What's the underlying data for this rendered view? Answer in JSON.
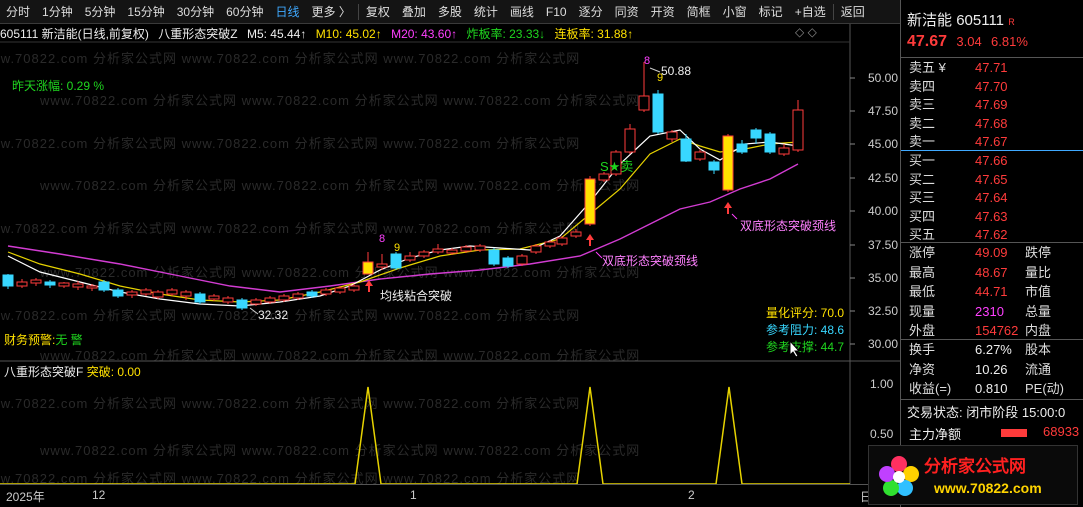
{
  "toolbar": {
    "items": [
      "分时",
      "1分钟",
      "5分钟",
      "15分钟",
      "30分钟",
      "60分钟",
      "日线",
      "更多 〉",
      "复权",
      "叠加",
      "多股",
      "统计",
      "画线",
      "F10",
      "逐分",
      "同资",
      "开资",
      "简框",
      "小窗",
      "标记",
      "+自选",
      "返回"
    ],
    "active_index": 6
  },
  "infobar": {
    "code_name": "605111  新洁能(日线,前复权)",
    "indicator_name": "八重形态突破Z",
    "ma5": "M5: 45.44↑",
    "ma10": "M10: 45.02↑",
    "ma20": "M20: 43.60↑",
    "zhaban": "炸板率: 23.33↓",
    "lianban": "连板率: 31.88↑"
  },
  "window_buttons": "◇ ◇",
  "annotations": {
    "zuotian": "昨天涨幅:  0.29 %",
    "caiwu_label": "财务预警:",
    "caiwu_value": "无 警",
    "price_high": "50.88",
    "price_low": "32.32",
    "label_junxian": "均线粘合突破",
    "label_neck1": "双底形态突破颈线",
    "label_neck2": "双底形态突破颈线",
    "sell_mark": "S★卖",
    "num8a": "8",
    "num9a": "9",
    "num8b": "8",
    "num9b": "9",
    "score_label": "量化评分: 70.0",
    "resist_label": "参考阻力: 48.6",
    "support_label": "参考支撑: 44.7"
  },
  "price_axis": [
    "50.00",
    "47.50",
    "45.00",
    "42.50",
    "40.00",
    "37.50",
    "35.00",
    "32.50",
    "30.00"
  ],
  "sub_axis": [
    "1.00",
    "0.50",
    "0.00"
  ],
  "subinfo": {
    "name": "八重形态突破F",
    "value": "突破: 0.00"
  },
  "xaxis": {
    "year": "2025年",
    "labels": [
      "12",
      "1",
      "2"
    ],
    "right_label": "日"
  },
  "right_panel": {
    "stock_name": "新洁能",
    "stock_code": "605111",
    "tag": "R",
    "price": "47.67",
    "change": "3.04",
    "change_pct": "6.81%",
    "asks": [
      {
        "label": "卖五 ¥",
        "price": "47.71"
      },
      {
        "label": "卖四",
        "price": "47.70"
      },
      {
        "label": "卖三",
        "price": "47.69"
      },
      {
        "label": "卖二",
        "price": "47.68"
      },
      {
        "label": "卖一",
        "price": "47.67"
      }
    ],
    "bids": [
      {
        "label": "买一",
        "price": "47.66"
      },
      {
        "label": "买二",
        "price": "47.65"
      },
      {
        "label": "买三",
        "price": "47.64"
      },
      {
        "label": "买四",
        "price": "47.63"
      },
      {
        "label": "买五",
        "price": "47.62"
      }
    ],
    "stats": [
      {
        "l1": "涨停",
        "v": "49.09",
        "c": "red",
        "l2": "跌停"
      },
      {
        "l1": "最高",
        "v": "48.67",
        "c": "red",
        "l2": "量比"
      },
      {
        "l1": "最低",
        "v": "44.71",
        "c": "red",
        "l2": "市值"
      },
      {
        "l1": "现量",
        "v": "2310",
        "c": "magenta",
        "l2": "总量"
      },
      {
        "l1": "外盘",
        "v": "154762",
        "c": "red",
        "l2": "内盘"
      }
    ],
    "stats2": [
      {
        "l1": "换手",
        "v": "6.27%",
        "l2": "股本"
      },
      {
        "l1": "净资",
        "v": "10.26",
        "l2": "流通"
      },
      {
        "l1": "收益(=)",
        "v": "0.810",
        "l2": "PE(动)"
      }
    ],
    "trade_status": "交易状态: 闭市阶段 15:00:0",
    "main_flow_label": "主力净额",
    "main_flow_value": "68933"
  },
  "watermark": {
    "text": "分析家公式网",
    "url": "www.70822.com",
    "bg_text": "www.70822.com 分析家公式网"
  },
  "colors": {
    "up": "#ff3b3b",
    "down": "#38d7ff",
    "ma5": "#ffffff",
    "ma10": "#ffe100",
    "ma20": "#ff40ff",
    "signal": "#ffe100"
  }
}
